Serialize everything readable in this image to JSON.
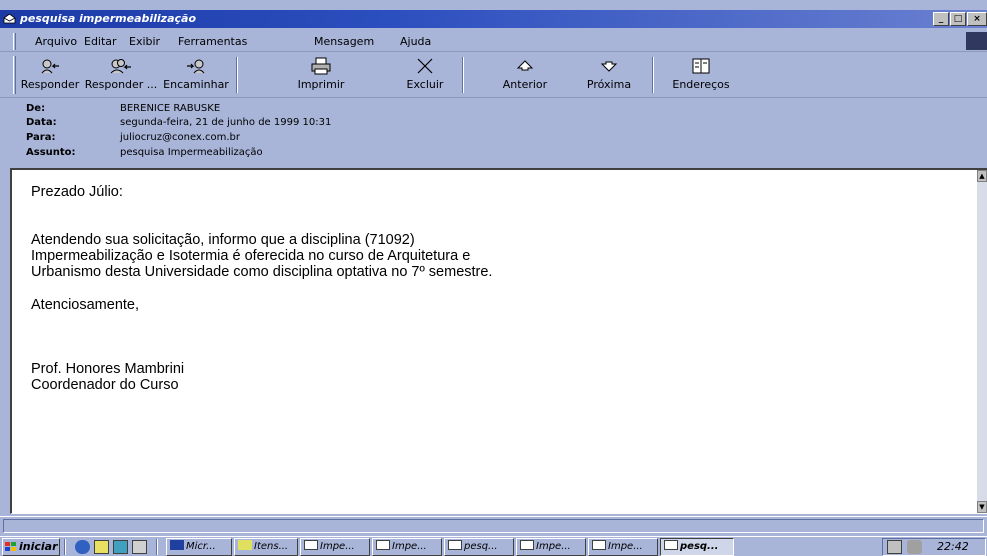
{
  "window": {
    "title": "pesquisa impermeabilização"
  },
  "menu": [
    "Arquivo",
    "Editar",
    "Exibir",
    "Ferramentas",
    "Mensagem",
    "Ajuda"
  ],
  "toolbar": {
    "reply": "Responder",
    "reply_all": "Responder ...",
    "forward": "Encaminhar",
    "print": "Imprimir",
    "delete": "Excluir",
    "previous": "Anterior",
    "next": "Próxima",
    "addresses": "Endereços"
  },
  "header": {
    "from_label": "De:",
    "from": "BERENICE RABUSKE",
    "date_label": "Data:",
    "date": "segunda-feira, 21 de junho de 1999 10:31",
    "to_label": "Para:",
    "to": "juliocruz@conex.com.br",
    "subject_label": "Assunto:",
    "subject": "pesquisa Impermeabilização"
  },
  "body": {
    "greeting": "Prezado Júlio:",
    "line1": "Atendendo sua solicitação, informo que a disciplina (71092)",
    "line2": "Impermeabilização e Isotermia é oferecida no curso de Arquitetura e",
    "line3": "Urbanismo desta Universidade como disciplina optativa no 7º semestre.",
    "closing": "Atenciosamente,",
    "signature1": "Prof. Honores Mambrini",
    "signature2": "Coordenador do Curso"
  },
  "taskbar": {
    "start": "iniciar",
    "tasks": [
      "Micr...",
      "Itens...",
      "Impe...",
      "Impe...",
      "pesq...",
      "Impe...",
      "Impe...",
      "pesq..."
    ],
    "clock": "22:42"
  },
  "colors": {
    "title_bar": "#1b3aa6",
    "chrome": "#a8b4d8"
  }
}
